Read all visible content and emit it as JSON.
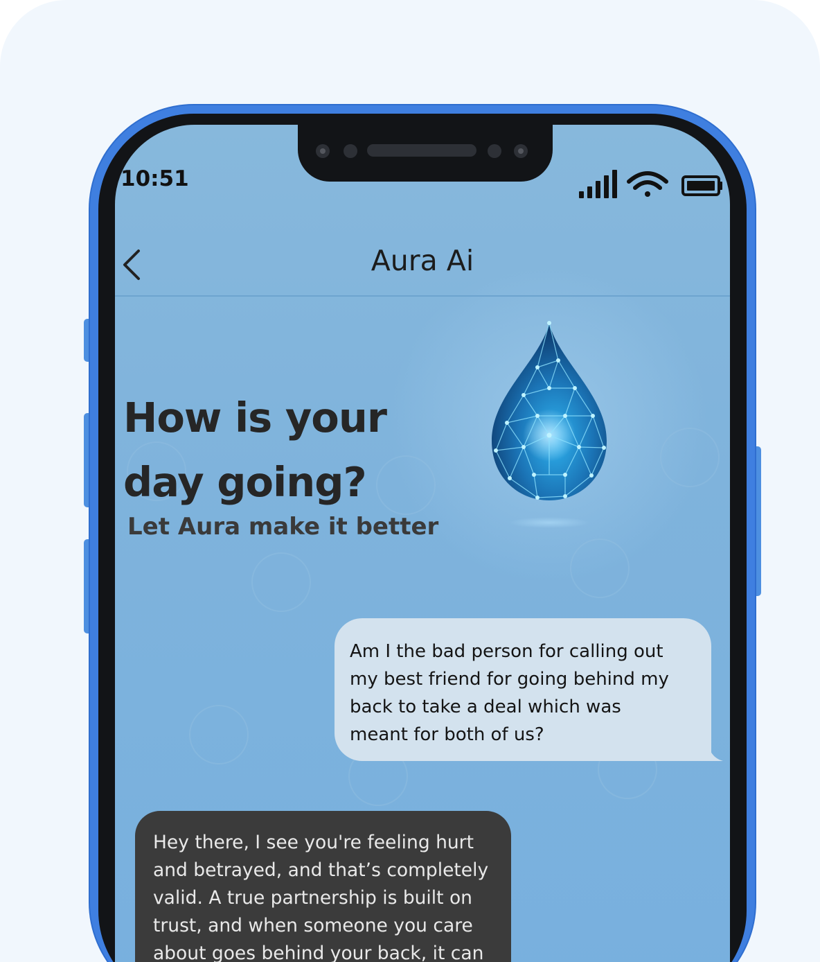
{
  "status_bar": {
    "time": "10:51",
    "icons": [
      "signal-icon",
      "wifi-icon",
      "battery-icon"
    ]
  },
  "header": {
    "back_icon": "chevron-left-icon",
    "title": "Aura Ai"
  },
  "hero": {
    "headline_line1": "How is your",
    "headline_line2": "day going?",
    "subheadline": "Let Aura make it better",
    "illustration": "water-drop-icon"
  },
  "chat": {
    "messages": [
      {
        "sender": "user",
        "lines": [
          "Am I the bad person for calling out",
          "my best friend for going behind my",
          "back to take a deal which was",
          "meant for both of us?"
        ]
      },
      {
        "sender": "ai",
        "lines": [
          "Hey there, I see you're feeling hurt",
          "and betrayed, and that’s completely",
          "valid. A true partnership is built on",
          "trust, and when someone you care",
          "about goes behind your back, it can"
        ]
      }
    ]
  },
  "colors": {
    "phone_frame": "#3f7fe0",
    "screen_bg": "#7fb3dc",
    "user_bubble": "#d3e2ee",
    "ai_bubble": "#3b3b3b"
  }
}
